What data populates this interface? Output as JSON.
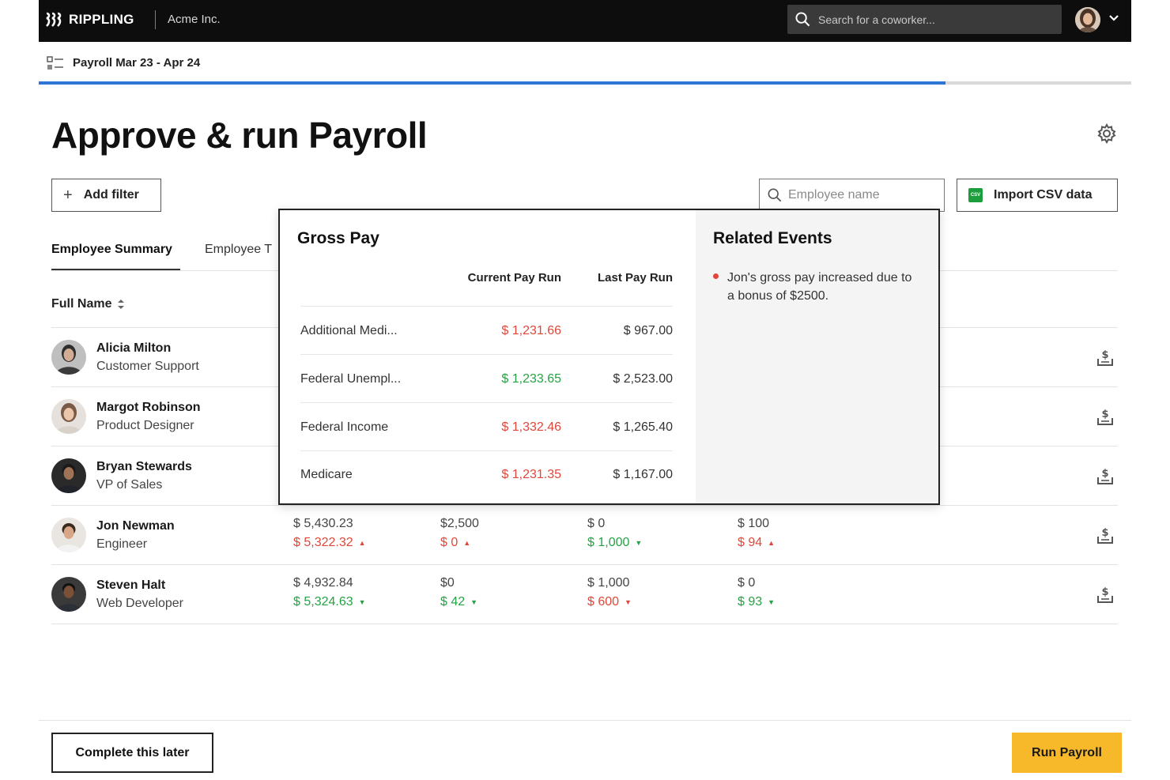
{
  "topbar": {
    "brand": "RIPPLING",
    "company": "Acme Inc.",
    "search_placeholder": "Search for a coworker..."
  },
  "breadcrumb": {
    "label": "Payroll Mar 23 - Apr 24",
    "progress_percent": 83
  },
  "page": {
    "title": "Approve & run Payroll"
  },
  "toolbar": {
    "add_filter_label": "Add filter",
    "employee_search_placeholder": "Employee name",
    "import_csv_label": "Import CSV data",
    "csv_badge": "CSV"
  },
  "tabs": [
    {
      "label": "Employee Summary",
      "active": true
    },
    {
      "label": "Employee T",
      "active": false
    }
  ],
  "table": {
    "name_header": "Full Name",
    "rows": [
      {
        "name": "Alicia Milton",
        "role": "Customer Support"
      },
      {
        "name": "Margot Robinson",
        "role": "Product Designer"
      },
      {
        "name": "Bryan Stewards",
        "role": "VP of Sales"
      },
      {
        "name": "Jon Newman",
        "role": "Engineer",
        "cells": [
          {
            "base": "$ 5,430.23",
            "current": "$ 5,322.32",
            "trend": "up"
          },
          {
            "base": "$2,500",
            "current": "$ 0",
            "trend": "up"
          },
          {
            "base": "$ 0",
            "current": "$ 1,000",
            "trend": "down"
          },
          {
            "base": "$ 100",
            "current": "$ 94",
            "trend": "up"
          }
        ]
      },
      {
        "name": "Steven Halt",
        "role": "Web Developer",
        "cells": [
          {
            "base": "$ 4,932.84",
            "current": "$ 5,324.63",
            "trend": "down"
          },
          {
            "base": "$0",
            "current": "$ 42",
            "trend": "down"
          },
          {
            "base": "$ 1,000",
            "current": "$ 600",
            "trend": "down"
          },
          {
            "base": "$ 0",
            "current": "$ 93",
            "trend": "down"
          }
        ]
      }
    ]
  },
  "popover": {
    "title": "Gross Pay",
    "col_current": "Current Pay Run",
    "col_last": "Last Pay Run",
    "rows": [
      {
        "label": "Additional Medi...",
        "current": "$ 1,231.66",
        "last": "$ 967.00",
        "trend": "up"
      },
      {
        "label": "Federal Unempl...",
        "current": "$ 1,233.65",
        "last": "$ 2,523.00",
        "trend": "down"
      },
      {
        "label": "Federal Income",
        "current": "$ 1,332.46",
        "last": "$ 1,265.40",
        "trend": "up"
      },
      {
        "label": "Medicare",
        "current": "$ 1,231.35",
        "last": "$ 1,167.00",
        "trend": "up"
      }
    ],
    "related_title": "Related Events",
    "related_events": [
      "Jon's gross pay increased due to a bonus of $2500."
    ]
  },
  "footer": {
    "later_label": "Complete this later",
    "run_label": "Run Payroll"
  },
  "colors": {
    "accent_progress": "#2e76d6",
    "run_button": "#f7b82a",
    "increase": "#e0473a",
    "decrease": "#25a244"
  },
  "icons": [
    "rippling-logo-icon",
    "search-icon",
    "chevron-down-icon",
    "payroll-list-icon",
    "gear-icon",
    "plus-icon",
    "csv-file-icon",
    "sort-icon",
    "payout-icon",
    "bullet-dot-icon"
  ]
}
